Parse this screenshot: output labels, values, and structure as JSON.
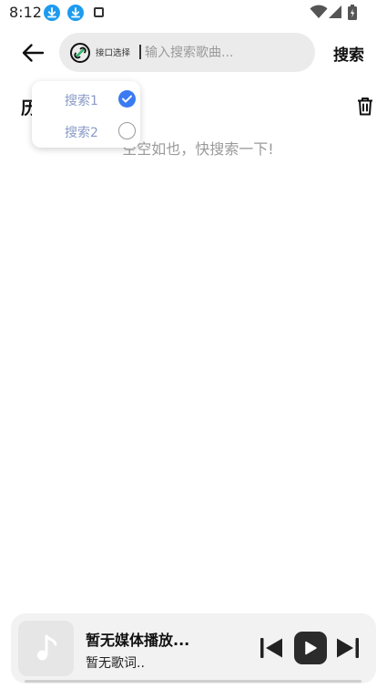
{
  "status_bar": {
    "time": "8:12",
    "icons": [
      "download-icon",
      "download-icon",
      "square-icon",
      "wifi-icon",
      "signal-icon",
      "battery-icon"
    ]
  },
  "header": {
    "api_selector_label": "接口选择",
    "search_placeholder": "输入搜索歌曲...",
    "search_value": "",
    "search_button": "搜索"
  },
  "history": {
    "title": "历",
    "empty_hint": "空空如也，快搜索一下!"
  },
  "dropdown": {
    "options": [
      {
        "label": "搜索1",
        "selected": true
      },
      {
        "label": "搜索2",
        "selected": false
      }
    ]
  },
  "player": {
    "title": "暂无媒体播放...",
    "lyric": "暂无歌词.."
  },
  "colors": {
    "accent": "#3a7af2",
    "api_icon_green": "#2fb36a",
    "download_blue": "#1e9bf0",
    "hint_gray": "#9a9a9a",
    "dropdown_text": "#8a9ac7"
  }
}
